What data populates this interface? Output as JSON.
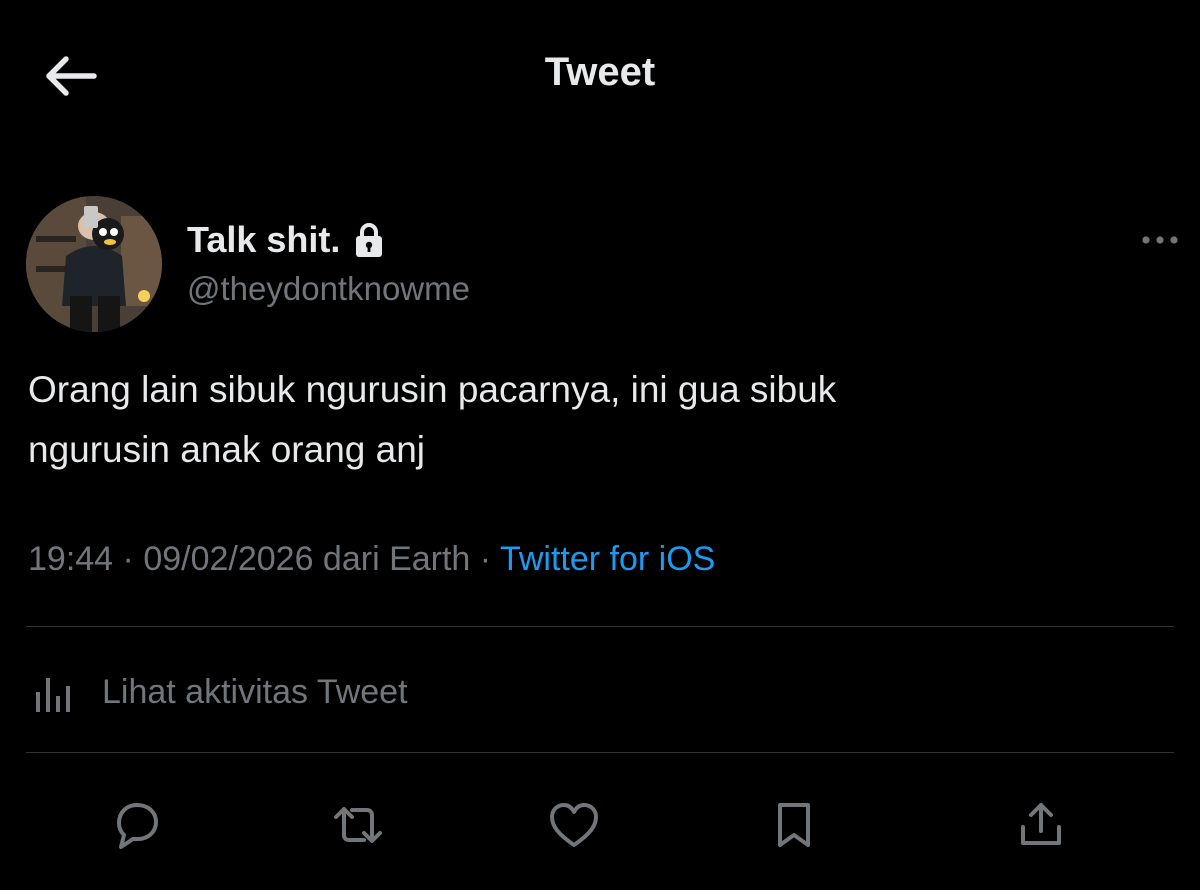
{
  "header": {
    "title": "Tweet",
    "back_icon": "arrow-left-icon"
  },
  "author": {
    "display_name": "Talk shit.",
    "handle": "@theydontknowme",
    "protected_icon": "lock-icon"
  },
  "tweet": {
    "text": "Orang lain sibuk ngurusin pacarnya, ini gua sibuk\nngurusin anak orang anj",
    "time": "19:44",
    "separator": " · ",
    "date_location": "09/02/2026 dari Earth",
    "source": "Twitter for iOS"
  },
  "activity": {
    "label": "Lihat aktivitas Tweet",
    "icon": "analytics-icon"
  },
  "actions": {
    "reply_icon": "reply-icon",
    "retweet_icon": "retweet-icon",
    "like_icon": "heart-icon",
    "bookmark_icon": "bookmark-icon",
    "share_icon": "share-icon"
  },
  "colors": {
    "background": "#000000",
    "text_primary": "#e7e9ea",
    "text_secondary": "#71767b",
    "accent": "#1d9bf0",
    "divider": "#2f3336"
  }
}
